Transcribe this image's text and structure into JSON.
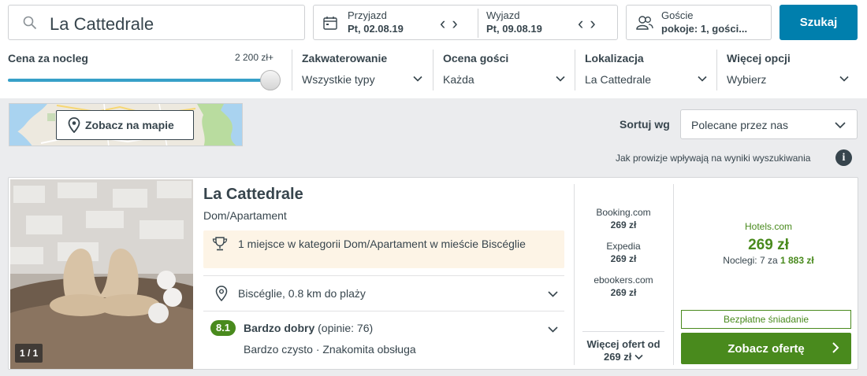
{
  "search": {
    "destination": "La Cattedrale",
    "button_label": "Szukaj"
  },
  "dates": {
    "checkin": {
      "label": "Przyjazd",
      "value": "Pt, 02.08.19"
    },
    "checkout": {
      "label": "Wyjazd",
      "value": "Pt, 09.08.19"
    }
  },
  "guests": {
    "label": "Goście",
    "value": "pokoje: 1, gości..."
  },
  "filters": {
    "price": {
      "label": "Cena za nocleg",
      "max": "2 200 zł+",
      "level": 1.0
    },
    "accommodation": {
      "label": "Zakwaterowanie",
      "value": "Wszystkie typy"
    },
    "rating": {
      "label": "Ocena gości",
      "value": "Każda"
    },
    "location": {
      "label": "Lokalizacja",
      "value": "La Cattedrale"
    },
    "more": {
      "label": "Więcej opcji",
      "value": "Wybierz"
    }
  },
  "map": {
    "button_label": "Zobacz na mapie"
  },
  "sort": {
    "label": "Sortuj wg",
    "value": "Polecane przez nas"
  },
  "commission_text": "Jak prowizje wpływają na wyniki wyszukiwania",
  "result": {
    "name": "La Cattedrale",
    "type": "Dom/Apartament",
    "photo_count": "1 / 1",
    "award": "1 miejsce w kategorii Dom/Apartament w mieście Biscéglie",
    "location": "Biscéglie, 0.8 km do plaży",
    "score": "8.1",
    "rating_label": "Bardzo dobry",
    "rating_reviews": "(opinie: 76)",
    "subratings": "Bardzo czysto · Znakomita obsługa",
    "deals": [
      {
        "provider": "Booking.com",
        "price": "269 zł"
      },
      {
        "provider": "Expedia",
        "price": "269 zł"
      },
      {
        "provider": "ebookers.com",
        "price": "269 zł"
      }
    ],
    "more_deals": {
      "label": "Więcej ofert od",
      "price": "269 zł"
    },
    "best": {
      "provider": "Hotels.com",
      "price": "269 zł",
      "nights_prefix": "Noclegi: 7 za",
      "nights_total": "1 883 zł",
      "perk": "Bezpłatne śniadanie",
      "cta": "Zobacz ofertę"
    }
  },
  "colors": {
    "brand_blue": "#007fad",
    "green": "#498a1d",
    "text": "#37454d"
  }
}
